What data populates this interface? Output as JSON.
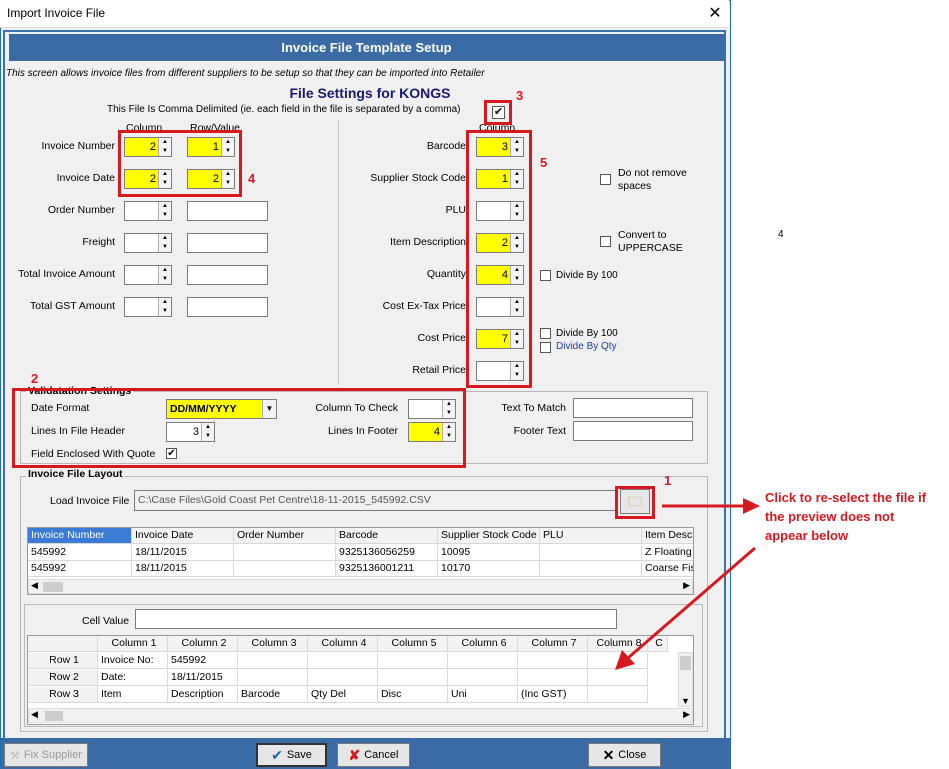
{
  "window": {
    "title": "Import Invoice File",
    "close": "✕"
  },
  "banner": "Invoice File Template Setup",
  "intro": "This screen allows invoice files from different suppliers to be setup so that they can be imported into Retailer",
  "heading": "File Settings for KONGS",
  "comma_label": "This File Is Comma Delimited (ie. each field in the file is separated by a comma)",
  "left_headers": {
    "column": "Column",
    "rowvalue": "Row/Value"
  },
  "left_fields": [
    {
      "label": "Invoice Number",
      "col": "2",
      "row": "1"
    },
    {
      "label": "Invoice Date",
      "col": "2",
      "row": "2"
    },
    {
      "label": "Order Number",
      "col": "",
      "row": ""
    },
    {
      "label": "Freight",
      "col": "",
      "row": ""
    },
    {
      "label": "Total Invoice Amount",
      "col": "",
      "row": ""
    },
    {
      "label": "Total GST Amount",
      "col": "",
      "row": ""
    }
  ],
  "right_header": "Column",
  "right_fields": [
    {
      "label": "Barcode",
      "col": "3"
    },
    {
      "label": "Supplier Stock Code",
      "col": "1"
    },
    {
      "label": "PLU",
      "col": ""
    },
    {
      "label": "Item Description",
      "col": "2"
    },
    {
      "label": "Quantity",
      "col": "4"
    },
    {
      "label": "Cost Ex-Tax Price",
      "col": ""
    },
    {
      "label": "Cost Price",
      "col": "7"
    },
    {
      "label": "Retail Price",
      "col": ""
    }
  ],
  "options": {
    "no_remove_spaces": "Do not remove spaces",
    "uppercase": "Convert to UPPERCASE",
    "qty_div": "Divide By 100",
    "cost_div": "Divide By 100",
    "cost_qty": "Divide By Qty"
  },
  "validation": {
    "title": "Validatation Settings",
    "date_format_label": "Date Format",
    "date_format": "DD/MM/YYYY",
    "lines_header_label": "Lines In File Header",
    "lines_header": "3",
    "quote_label": "Field Enclosed With Quote",
    "col_check_label": "Column To Check",
    "col_check": "",
    "lines_footer_label": "Lines In Footer",
    "lines_footer": "4",
    "text_match_label": "Text To Match",
    "footer_text_label": "Footer Text"
  },
  "layout": {
    "title": "Invoice File Layout",
    "load_label": "Load Invoice File",
    "path": "C:\\Case Files\\Gold Coast Pet Centre\\18-11-2015_545992.CSV",
    "preview_headers": [
      "Invoice Number",
      "Invoice Date",
      "Order Number",
      "Barcode",
      "Supplier Stock Code",
      "PLU",
      "Item Descr"
    ],
    "preview_rows": [
      [
        "545992",
        "18/11/2015",
        "",
        "9325136056259",
        "10095",
        "",
        "Z Floating S"
      ],
      [
        "545992",
        "18/11/2015",
        "",
        "9325136001211",
        "10170",
        "",
        "Coarse Fis"
      ]
    ],
    "cell_value_label": "Cell Value",
    "raw_headers": [
      "",
      "Column 1",
      "Column 2",
      "Column 3",
      "Column 4",
      "Column 5",
      "Column 6",
      "Column 7",
      "Column 8",
      "C"
    ],
    "raw_rows": [
      [
        "Row 1",
        "Invoice No:",
        "545992",
        "",
        "",
        "",
        "",
        "",
        ""
      ],
      [
        "Row 2",
        "Date:",
        "18/11/2015",
        "",
        "",
        "",
        "",
        "",
        ""
      ],
      [
        "Row 3",
        "Item",
        "Description",
        "Barcode",
        "Qty Del",
        "Disc",
        "Uni",
        "(Inc GST)",
        ""
      ]
    ]
  },
  "buttons": {
    "fix": "Fix Supplier",
    "save": "Save",
    "cancel": "Cancel",
    "close": "Close"
  },
  "annotations": {
    "n1": "1",
    "n2": "2",
    "n3": "3",
    "n4": "4",
    "n5": "5",
    "callout": "Click to re-select the file if the preview does not appear below",
    "stray": "4"
  },
  "colors": {
    "banner": "#3a6ba5",
    "highlight": "#ffff00",
    "annotation": "#d7191f"
  }
}
